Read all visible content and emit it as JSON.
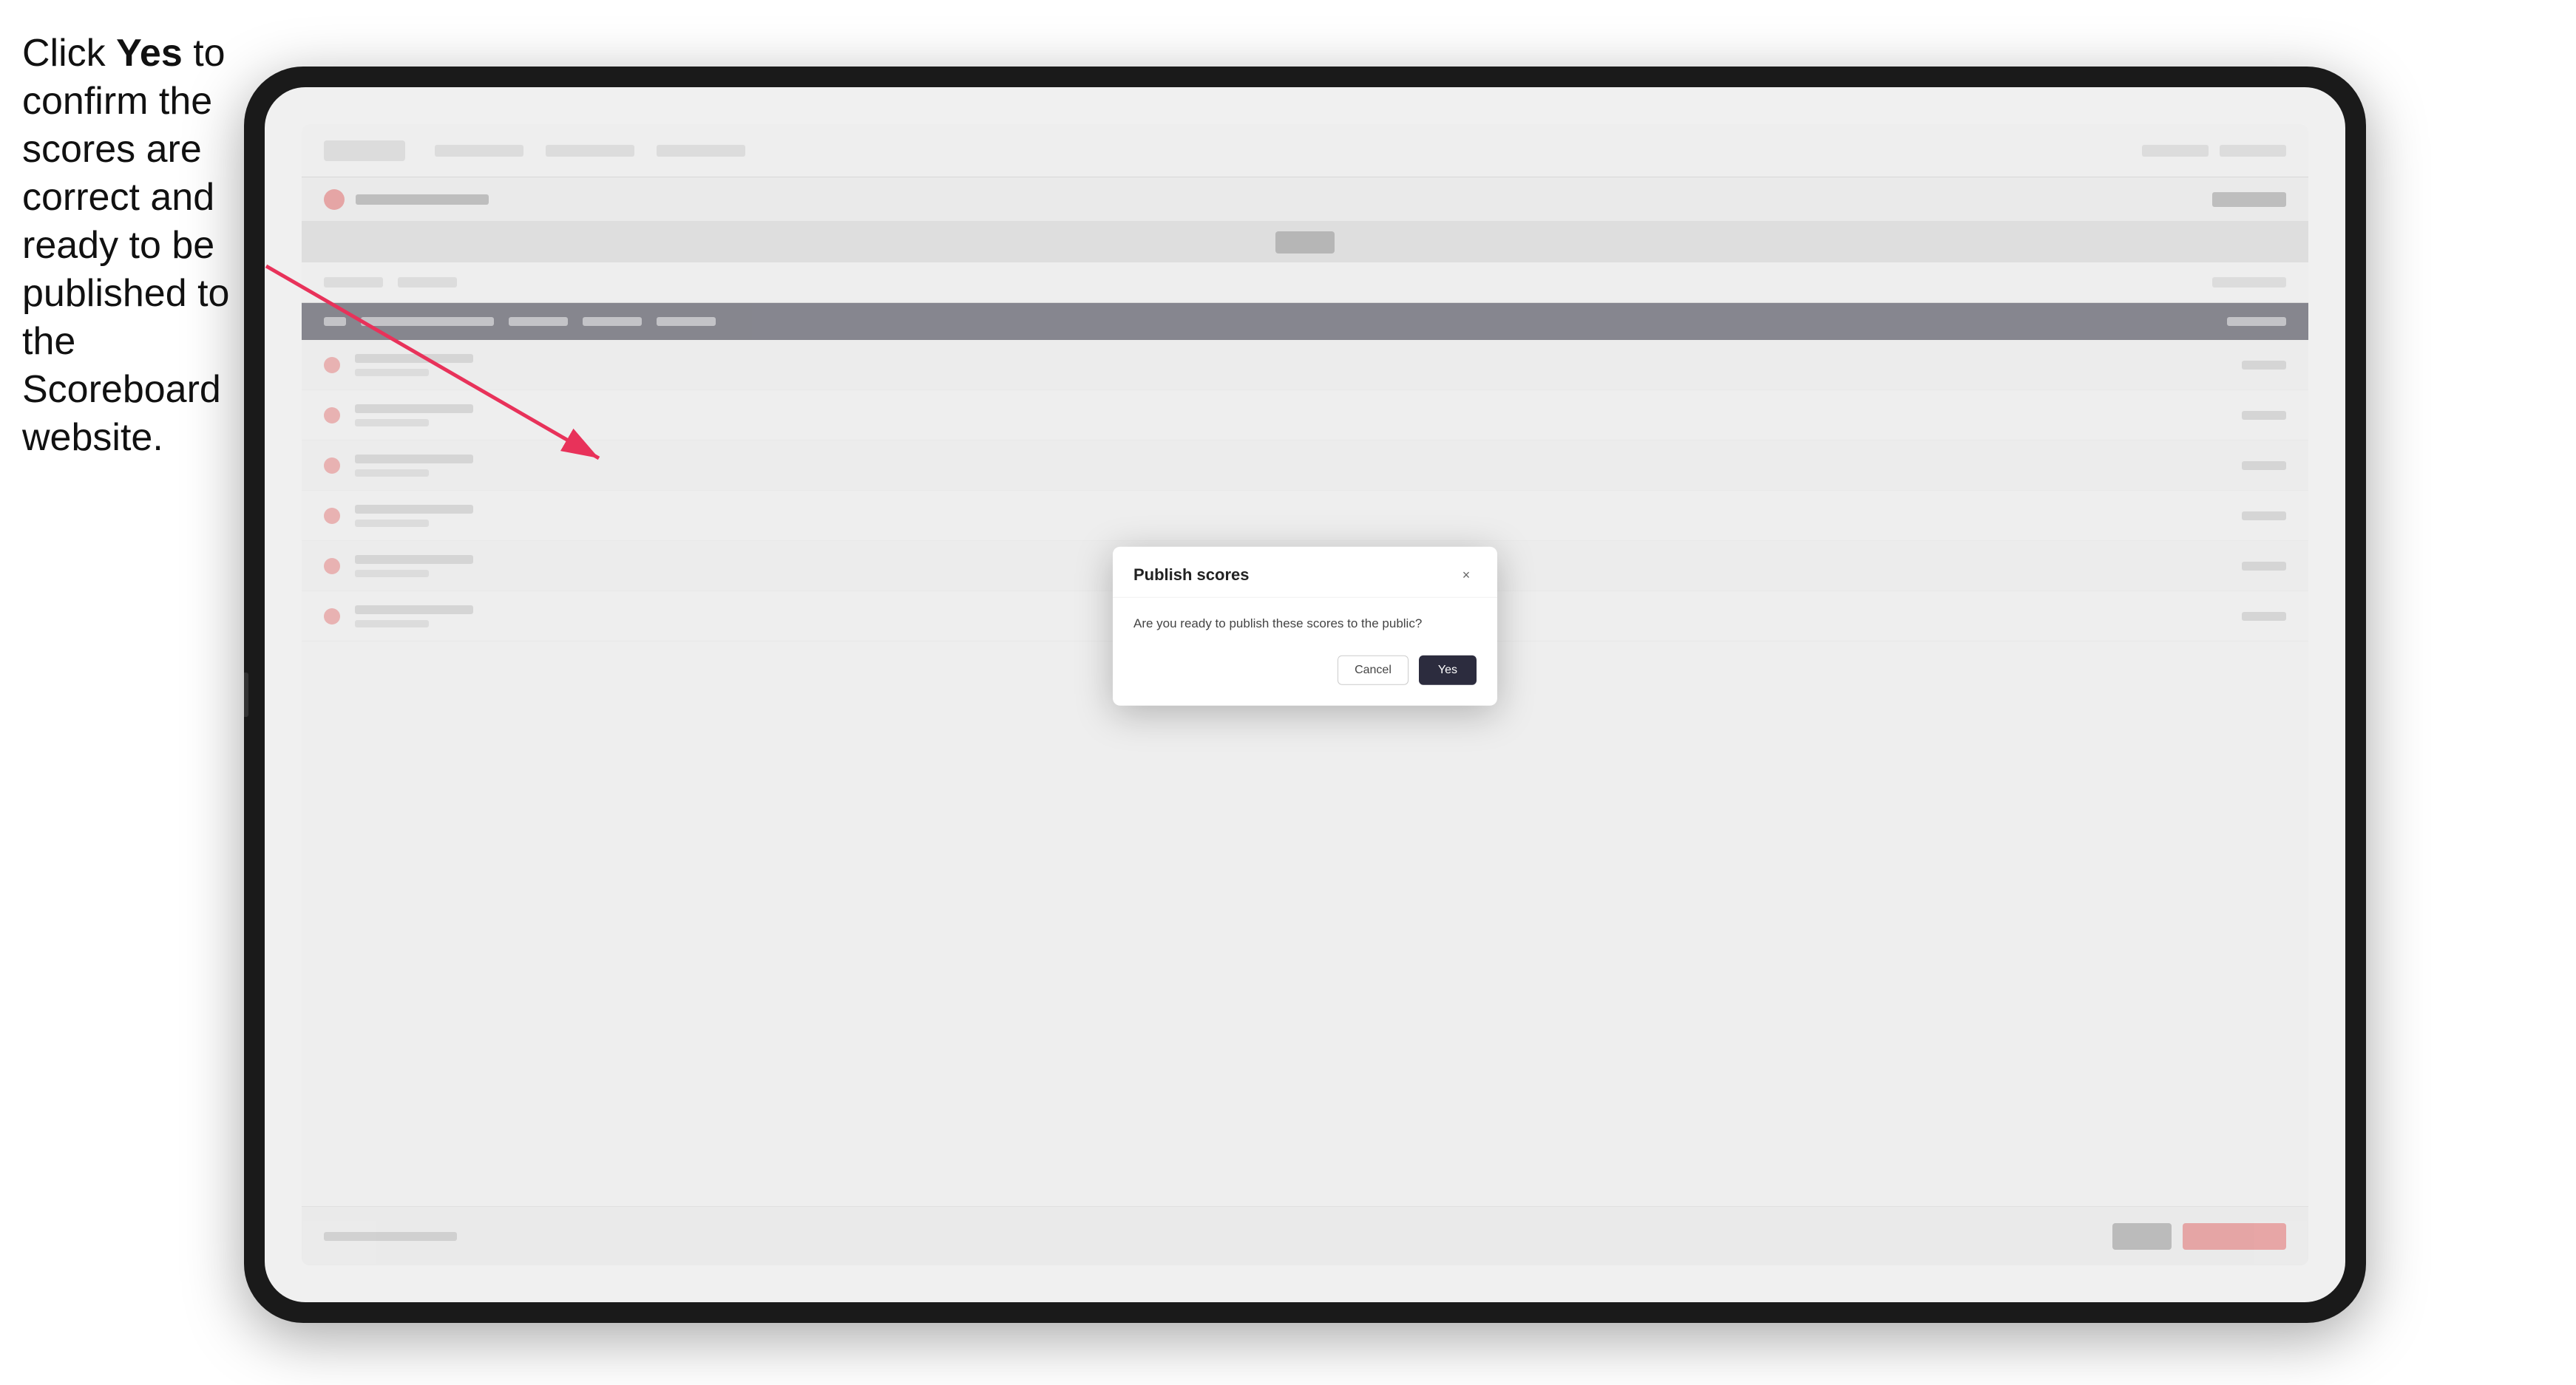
{
  "instruction": {
    "text_part1": "Click ",
    "bold": "Yes",
    "text_part2": " to confirm the scores are correct and ready to be published to the Scoreboard website."
  },
  "modal": {
    "title": "Publish scores",
    "message": "Are you ready to publish these scores to the public?",
    "cancel_label": "Cancel",
    "yes_label": "Yes",
    "close_icon": "×"
  },
  "colors": {
    "btn_yes_bg": "#2c2c3e",
    "btn_yes_text": "#ffffff",
    "arrow_color": "#e8325a"
  }
}
